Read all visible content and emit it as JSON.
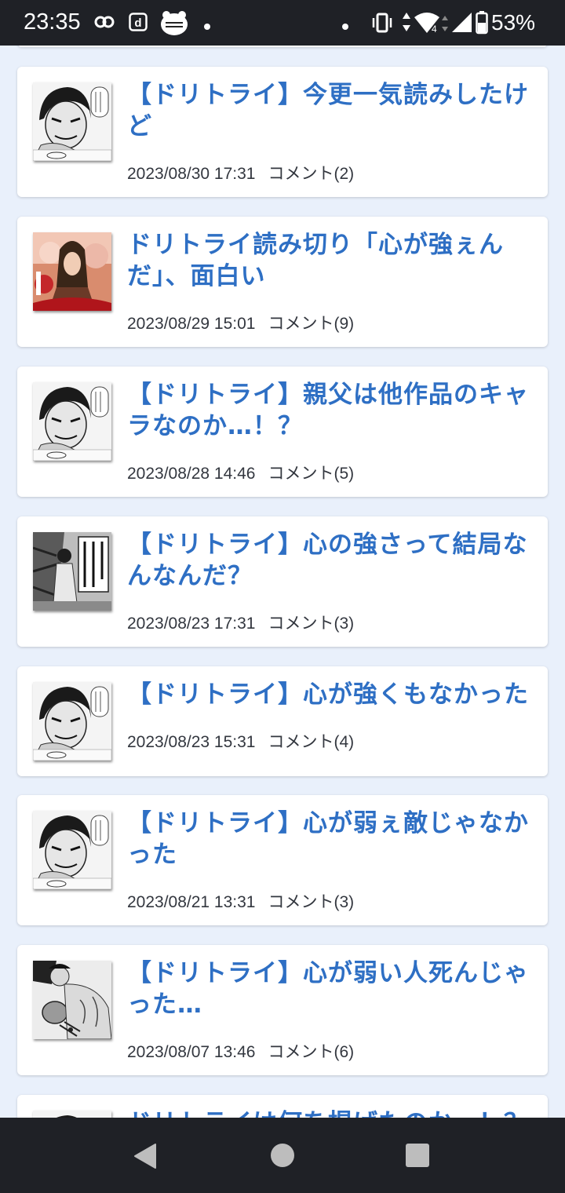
{
  "status_bar": {
    "time": "23:35",
    "battery_percent": "53%",
    "network": "4",
    "icons": [
      "link-icon",
      "d-app-icon",
      "app-badge-icon",
      "dot-icon",
      "vibrate-icon",
      "data-arrows-icon",
      "wifi-icon",
      "signal-icon",
      "battery-icon"
    ]
  },
  "posts": [
    {
      "title": "【ドリトライ】今更一気読みしたけど",
      "date": "2023/08/30 17:31",
      "comments": "コメント(2)",
      "thumb": "manga-face"
    },
    {
      "title": "ドリトライ読み切り「心が強ぇんだ」、面白い",
      "date": "2023/08/29 15:01",
      "comments": "コメント(9)",
      "thumb": "color-cover"
    },
    {
      "title": "【ドリトライ】親父は他作品のキャラなのか…！？",
      "date": "2023/08/28 14:46",
      "comments": "コメント(5)",
      "thumb": "manga-face"
    },
    {
      "title": "【ドリトライ】心の強さって結局なんなんだ？",
      "date": "2023/08/23 17:31",
      "comments": "コメント(3)",
      "thumb": "manga-panel"
    },
    {
      "title": "【ドリトライ】心が強くもなかった",
      "date": "2023/08/23 15:31",
      "comments": "コメント(4)",
      "thumb": "manga-face"
    },
    {
      "title": "【ドリトライ】心が弱ぇ敵じゃなかった",
      "date": "2023/08/21 13:31",
      "comments": "コメント(3)",
      "thumb": "manga-face"
    },
    {
      "title": "【ドリトライ】心が弱い人死んじゃった…",
      "date": "2023/08/07 13:46",
      "comments": "コメント(6)",
      "thumb": "manga-boxer"
    },
    {
      "title": "ドリトライは何を掲げたのか…！？",
      "date": "",
      "comments": "",
      "thumb": "manga-face"
    }
  ],
  "nav": {
    "back": "back-icon",
    "home": "home-icon",
    "recents": "recents-icon"
  }
}
